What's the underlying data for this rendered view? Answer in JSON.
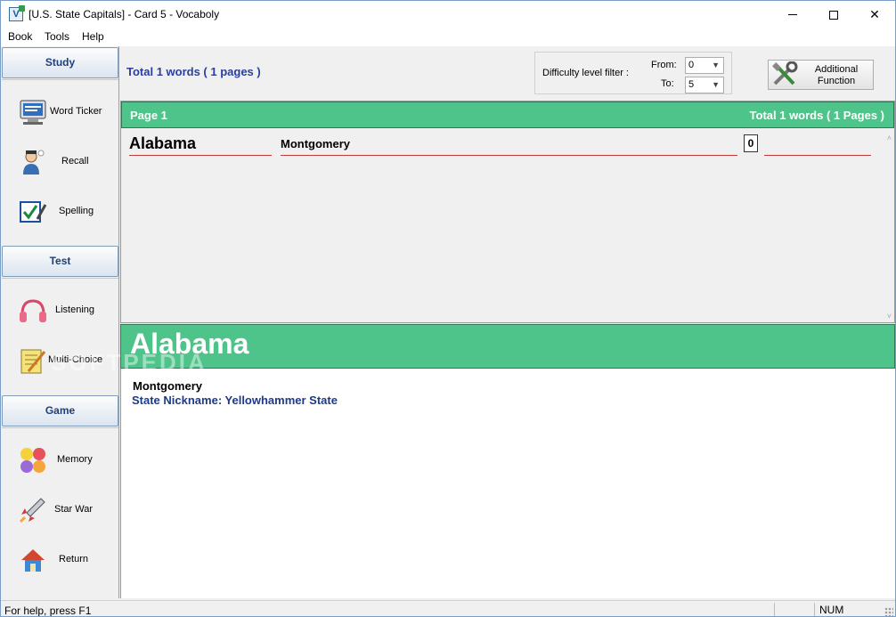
{
  "window": {
    "title": "[U.S. State Capitals] - Card 5 - Vocaboly",
    "app_icon_letter": "V",
    "min_label": "",
    "max_label": "",
    "close_label": "✕"
  },
  "menu": [
    "Book",
    "Tools",
    "Help"
  ],
  "sidebar": {
    "sections": {
      "study": "Study",
      "test": "Test",
      "game": "Game"
    },
    "study_items": [
      {
        "label": "Word Ticker",
        "icon": "monitor-icon"
      },
      {
        "label": "Recall",
        "icon": "person-thinking-icon"
      },
      {
        "label": "Spelling",
        "icon": "checkbox-pen-icon"
      }
    ],
    "test_items": [
      {
        "label": "Listening",
        "icon": "headphones-icon"
      },
      {
        "label": "Multi-Choice",
        "icon": "notepad-pencil-icon"
      }
    ],
    "game_items": [
      {
        "label": "Memory",
        "icon": "smiley-faces-icon"
      },
      {
        "label": "Star War",
        "icon": "rocket-icon"
      },
      {
        "label": "Return",
        "icon": "house-icon"
      }
    ]
  },
  "toolbar": {
    "total_words": "Total 1 words ( 1 pages )",
    "filter_label": "Difficulty level filter :",
    "from_label": "From:",
    "to_label": "To:",
    "from_value": "0",
    "to_value": "5",
    "additional_function": "Additional Function"
  },
  "list": {
    "page_label": "Page 1",
    "total_pages": "Total 1 words ( 1 Pages )",
    "rows": [
      {
        "word": "Alabama",
        "meaning": "Montgomery",
        "level": "0"
      }
    ]
  },
  "detail": {
    "word": "Alabama",
    "meaning": "Montgomery",
    "note": "State Nickname: Yellowhammer State",
    "watermark": "SOFTPEDIA"
  },
  "status": {
    "help": "For help, press F1",
    "num": "NUM"
  },
  "colors": {
    "header_green": "#4fc48a",
    "accent_blue": "#2a3f9d",
    "underline_red": "#c23a3a"
  }
}
